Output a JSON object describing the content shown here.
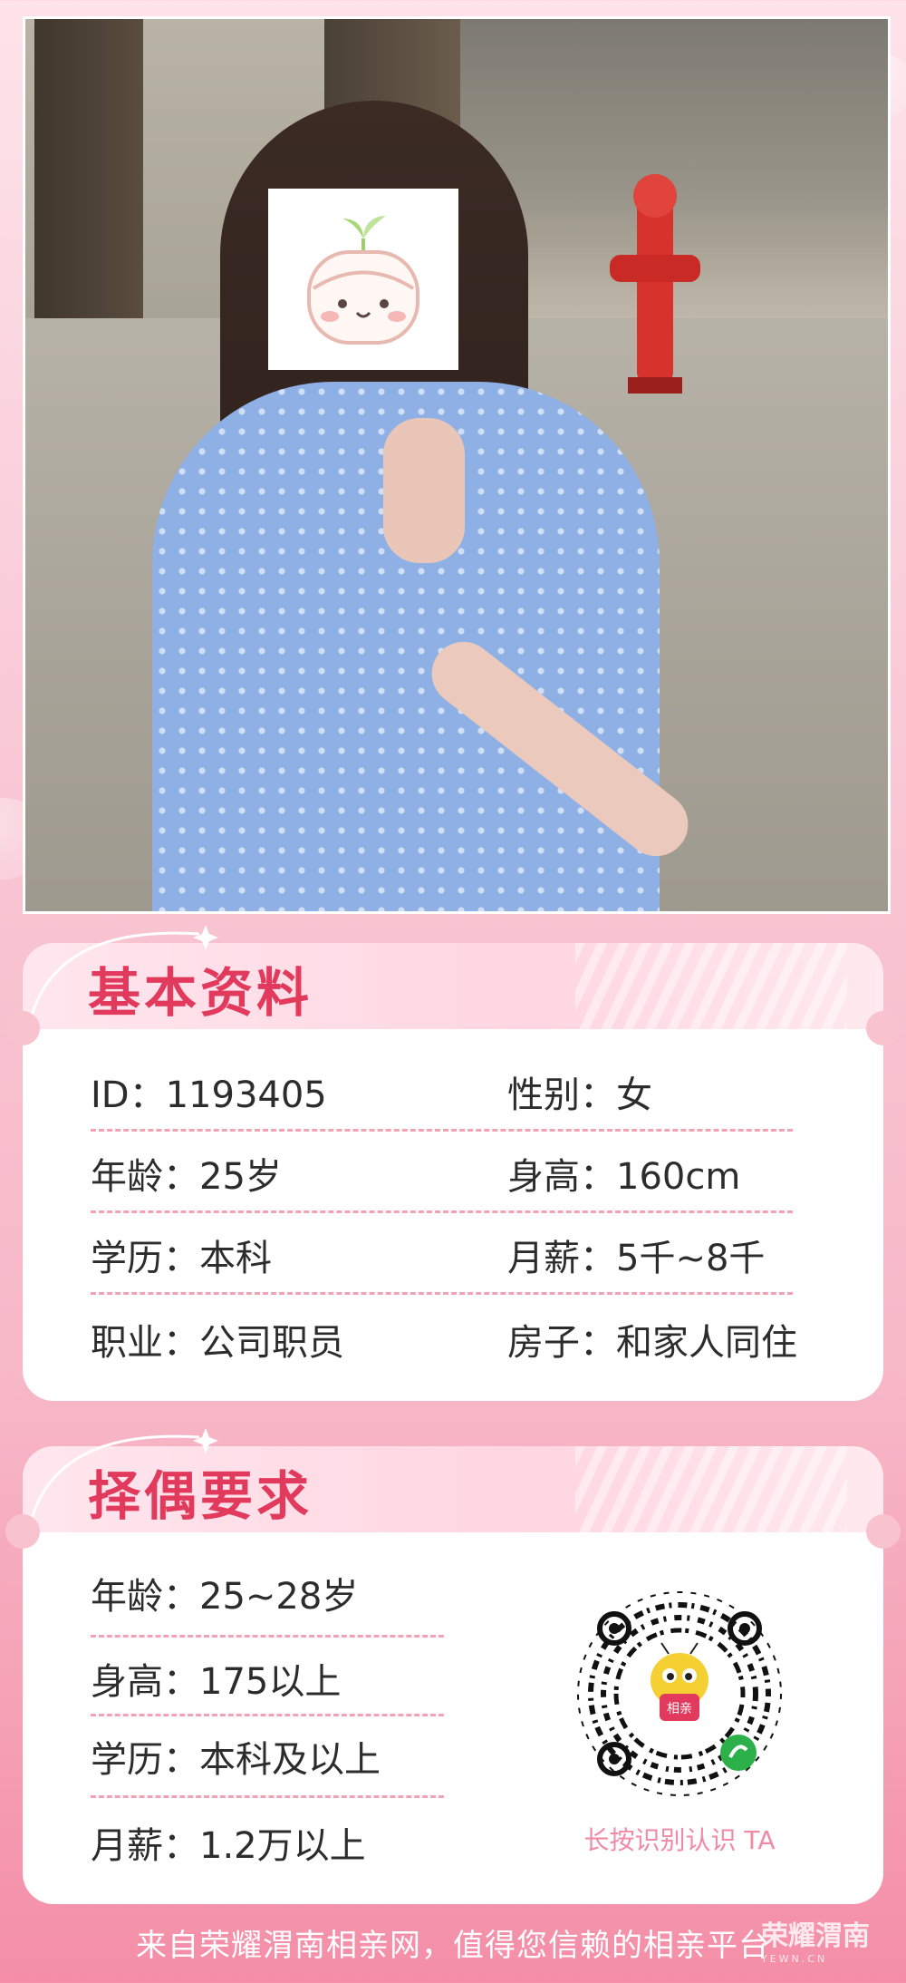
{
  "profile_card": {
    "title": "基本资料",
    "fields": [
      {
        "label": "ID",
        "value": "1193405"
      },
      {
        "label": "性别",
        "value": "女"
      },
      {
        "label": "年龄",
        "value": "25岁"
      },
      {
        "label": "身高",
        "value": "160cm"
      },
      {
        "label": "学历",
        "value": "本科"
      },
      {
        "label": "月薪",
        "value": "5千~8千"
      },
      {
        "label": "职业",
        "value": "公司职员"
      },
      {
        "label": "房子",
        "value": "和家人同住"
      }
    ]
  },
  "requirements_card": {
    "title": "择偶要求",
    "fields": [
      {
        "label": "年龄",
        "value": "25~28岁"
      },
      {
        "label": "身高",
        "value": "175以上"
      },
      {
        "label": "学历",
        "value": "本科及以上"
      },
      {
        "label": "月薪",
        "value": "1.2万以上"
      }
    ],
    "qr_badge": "相亲",
    "qr_caption": "长按识别认识 TA"
  },
  "separator": "：",
  "footer_text": "来自荣耀渭南相亲网，值得您信赖的相亲平台",
  "watermark": {
    "text": "荣耀渭南",
    "sub": "YEWN.CN"
  },
  "colors": {
    "accent": "#e23a5c",
    "dash": "#f3a2b6",
    "caption": "#f08aa5"
  }
}
